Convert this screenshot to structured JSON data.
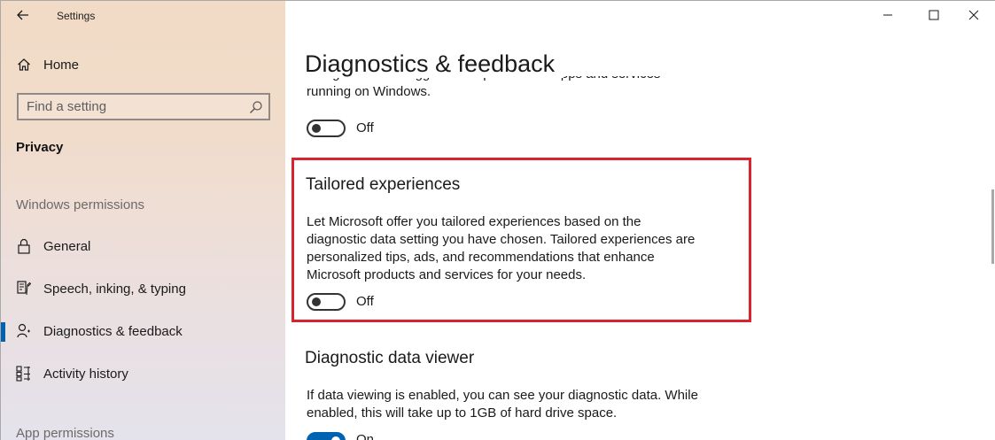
{
  "window": {
    "app_title": "Settings",
    "back_label": "Back",
    "minimize_icon": "minimize-icon",
    "maximize_icon": "maximize-icon",
    "close_icon": "close-icon"
  },
  "sidebar": {
    "home_label": "Home",
    "search_placeholder": "Find a setting",
    "section_heading": "Privacy",
    "group_windows": "Windows permissions",
    "group_app": "App permissions",
    "items": [
      {
        "label": "General",
        "icon": "lock-icon"
      },
      {
        "label": "Speech, inking, & typing",
        "icon": "speech-icon"
      },
      {
        "label": "Diagnostics & feedback",
        "icon": "diagnostics-icon",
        "selected": true
      },
      {
        "label": "Activity history",
        "icon": "activity-history-icon"
      }
    ]
  },
  "main": {
    "page_title": "Diagnostics & feedback",
    "clipped_line": "recognition and suggestion capabilities of apps and services",
    "clipped_line2": "running on Windows.",
    "toggle1_state": "Off",
    "tailored_title": "Tailored experiences",
    "tailored_desc": [
      "Let Microsoft offer you tailored experiences based on the",
      "diagnostic data setting you have chosen. Tailored experiences are",
      "personalized tips, ads, and recommendations that enhance",
      "Microsoft products and services for your needs."
    ],
    "toggle2_state": "Off",
    "viewer_title": "Diagnostic data viewer",
    "viewer_desc": [
      "If data viewing is enabled, you can see your diagnostic data. While",
      "enabled, this will take up to 1GB of hard drive space."
    ],
    "toggle3_state": "On"
  },
  "colors": {
    "accent": "#0063b1",
    "highlight": "#d9232e"
  }
}
